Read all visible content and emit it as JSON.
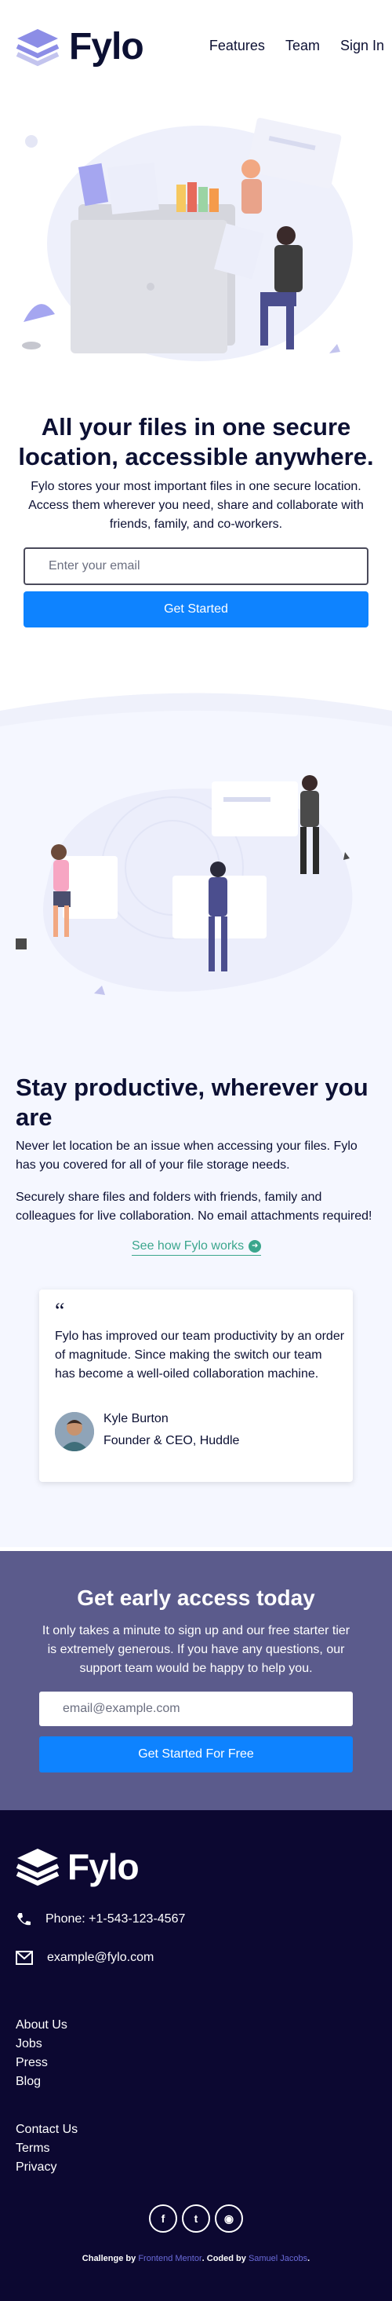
{
  "brand": {
    "name": "Fylo"
  },
  "nav": {
    "items": [
      "Features",
      "Team",
      "Sign In"
    ]
  },
  "hero": {
    "title": "All your files in one secure location, accessible anywhere.",
    "text": "Fylo stores your most important files in one secure location. Access them wherever you need, share and collaborate with friends, family, and co-workers.",
    "email_placeholder": "Enter your email",
    "button": "Get Started"
  },
  "productive": {
    "title": "Stay productive, wherever you are",
    "text1": "Never let location be an issue when accessing your files. Fylo has you covered for all of your file storage needs.",
    "text2": "Securely share files and folders with friends, family and colleagues for live collaboration. No email attachments required!",
    "link": "See how Fylo works"
  },
  "testimonial": {
    "quote_mark": "“",
    "text": "Fylo has improved our team productivity by an order of magnitude. Since making the switch our team has become a well-oiled collaboration machine.",
    "name": "Kyle Burton",
    "role": "Founder & CEO, Huddle"
  },
  "cta": {
    "title": "Get early access today",
    "text": "It only takes a minute to sign up and our free starter tier is extremely generous. If you have any questions, our support team would be happy to help you.",
    "email_placeholder": "email@example.com",
    "button": "Get Started For Free"
  },
  "footer": {
    "phone": "Phone: +1-543-123-4567",
    "email": "example@fylo.com",
    "links1": [
      "About Us",
      "Jobs",
      "Press",
      "Blog"
    ],
    "links2": [
      "Contact Us",
      "Terms",
      "Privacy"
    ],
    "social": [
      "facebook-icon",
      "twitter-icon",
      "instagram-icon"
    ],
    "attribution": {
      "pre": "Challenge by",
      "fm": "Frontend Mentor",
      "mid": ". Coded by",
      "author": "Samuel Jacobs",
      "end": "."
    }
  },
  "colors": {
    "accent": "#0e83ff",
    "navy": "#0c1033",
    "footer_bg": "#0c0831",
    "cta_bg": "#5b5b8c",
    "link": "#3ba68d"
  }
}
